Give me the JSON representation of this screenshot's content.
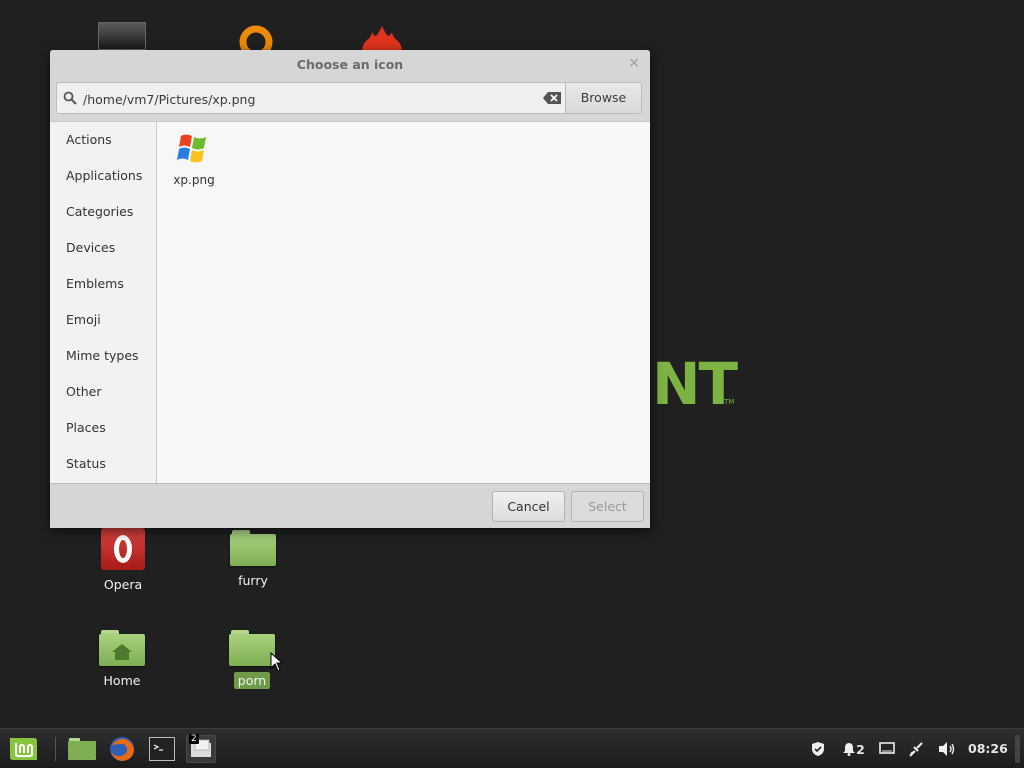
{
  "dialog": {
    "title": "Choose an icon",
    "close_glyph": "×",
    "search": {
      "value": "/home/vm7/Pictures/xp.png",
      "icon": "search-icon",
      "clear_icon": "clear-icon"
    },
    "browse_label": "Browse",
    "sidebar": {
      "items": [
        {
          "label": "Actions"
        },
        {
          "label": "Applications"
        },
        {
          "label": "Categories"
        },
        {
          "label": "Devices"
        },
        {
          "label": "Emblems"
        },
        {
          "label": "Emoji"
        },
        {
          "label": "Mime types"
        },
        {
          "label": "Other"
        },
        {
          "label": "Places"
        },
        {
          "label": "Status"
        }
      ]
    },
    "icons": [
      {
        "label": "xp.png",
        "icon": "windows-xp-logo-icon"
      }
    ],
    "cancel_label": "Cancel",
    "select_label": "Select",
    "select_enabled": false
  },
  "desktop": {
    "wallpaper_text": "NT",
    "wallpaper_tm": "TM",
    "icons": [
      {
        "label": "Opera",
        "icon": "opera-icon"
      },
      {
        "label": "furry",
        "icon": "folder-icon"
      },
      {
        "label": "Home",
        "icon": "home-folder-icon"
      },
      {
        "label": "porn",
        "icon": "folder-icon",
        "selected": true
      }
    ]
  },
  "panel": {
    "launchers": [
      "files-icon",
      "firefox-icon",
      "terminal-icon",
      "window-icon"
    ],
    "window_badge": "2",
    "tray": {
      "notification_count": "2"
    },
    "clock": "08:26"
  },
  "colors": {
    "accent": "#7cb342",
    "panel": "#1c1c1c",
    "dialog": "#d6d6d6"
  }
}
